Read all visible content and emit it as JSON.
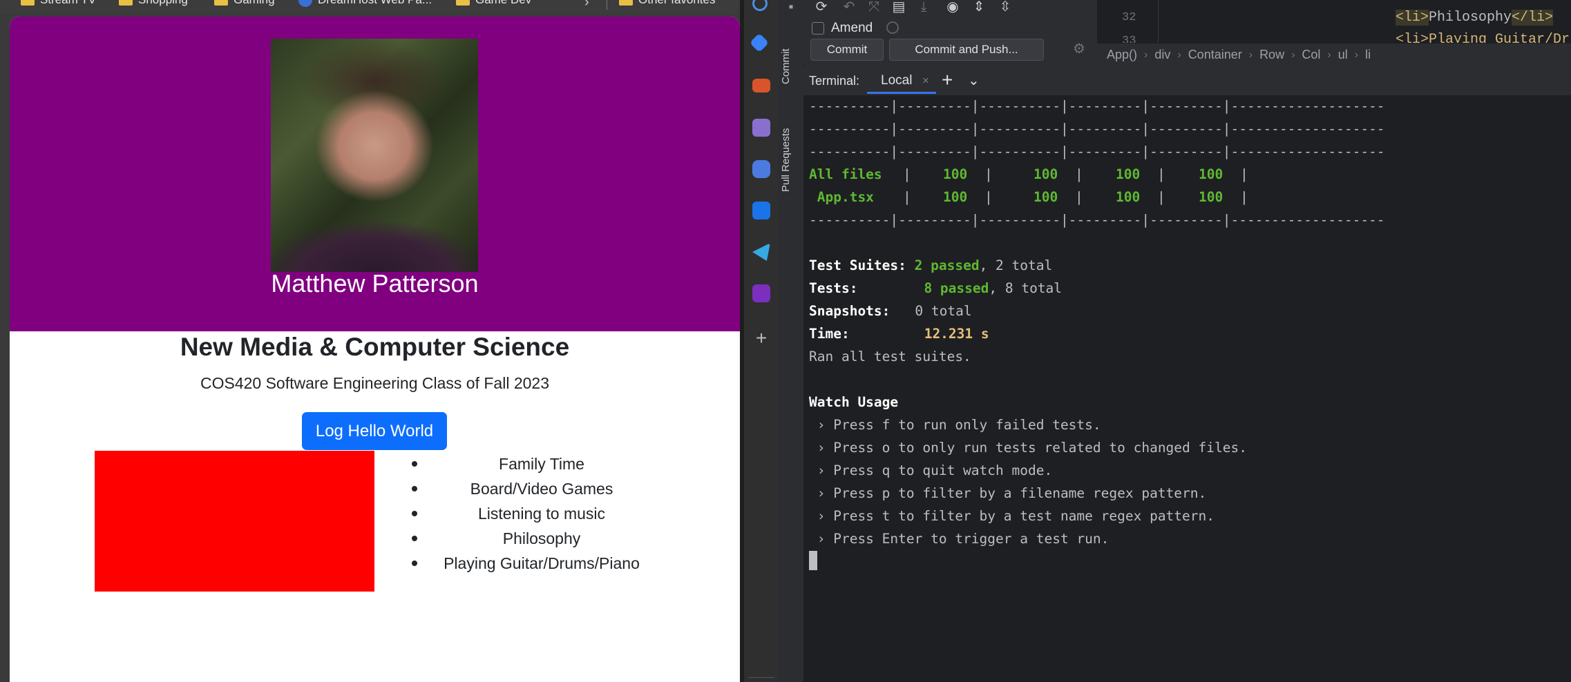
{
  "bookmarks": [
    {
      "label": "Stream TV",
      "icon": "folder-icon"
    },
    {
      "label": "Shopping",
      "icon": "folder-icon"
    },
    {
      "label": "Gaming",
      "icon": "folder-icon"
    },
    {
      "label": "DreamHost Web Pa...",
      "icon": "globe-icon"
    },
    {
      "label": "Game Dev",
      "icon": "folder-icon"
    },
    {
      "label": "Other favorites",
      "icon": "folder-icon"
    }
  ],
  "page": {
    "name": "Matthew Patterson",
    "heading": "New Media & Computer Science",
    "subtitle": "COS420 Software Engineering Class of Fall 2023",
    "button_label": "Log Hello World",
    "hobbies": [
      "Family Time",
      "Board/Video Games",
      "Listening to music",
      "Philosophy",
      "Playing Guitar/Drums/Piano"
    ],
    "colors": {
      "hero": "#800080",
      "button": "#0d6efd",
      "box": "#ff0000"
    }
  },
  "ide": {
    "side_tabs": [
      "Commit",
      "Pull Requests"
    ],
    "amend_label": "Amend",
    "commit_button": "Commit",
    "commit_push_button": "Commit and Push...",
    "editor": {
      "line_number": "32",
      "line_number_next": "33",
      "code_tag_open": "<li>",
      "code_text": "Philosophy",
      "code_tag_close": "</li>",
      "code_next": "<li>Playing Guitar/Dr"
    },
    "breadcrumb": [
      "App()",
      "div",
      "Container",
      "Row",
      "Col",
      "ul",
      "li"
    ],
    "terminal_label": "Terminal:",
    "terminal_tab": "Local"
  },
  "terminal": {
    "separator": "----------|---------|----------|---------|---------|-------------------",
    "rows": [
      {
        "file": "All files",
        "values": [
          "100",
          "100",
          "100",
          "100"
        ]
      },
      {
        "file": " App.tsx",
        "values": [
          "100",
          "100",
          "100",
          "100"
        ]
      }
    ],
    "test_suites_label": "Test Suites:",
    "test_suites_passed": "2 passed",
    "test_suites_total": ", 2 total",
    "tests_label": "Tests:",
    "tests_passed": "8 passed",
    "tests_total": ", 8 total",
    "snapshots_label": "Snapshots:",
    "snapshots_value": "0 total",
    "time_label": "Time:",
    "time_value": "12.231 s",
    "ran_all": "Ran all test suites.",
    "watch_usage": "Watch Usage",
    "watch_items": [
      " › Press f to run only failed tests.",
      " › Press o to only run tests related to changed files.",
      " › Press q to quit watch mode.",
      " › Press p to filter by a filename regex pattern.",
      " › Press t to filter by a test name regex pattern.",
      " › Press Enter to trigger a test run."
    ]
  }
}
